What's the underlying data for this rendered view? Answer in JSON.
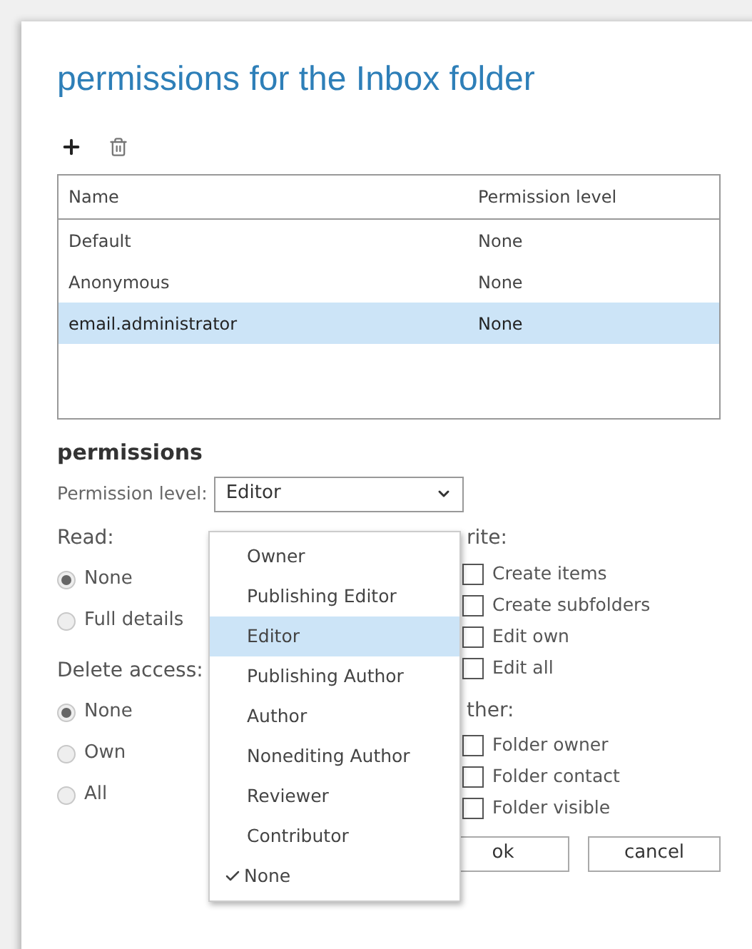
{
  "dialog": {
    "title": "permissions for the Inbox folder"
  },
  "toolbar": [
    {
      "kind": "add"
    },
    {
      "kind": "delete"
    }
  ],
  "table": {
    "columns": [
      "Name",
      "Permission level"
    ],
    "rows": [
      {
        "name": "Default",
        "level_text": "None",
        "selected": false
      },
      {
        "name": "Anonymous",
        "level_text": "None",
        "selected": false
      },
      {
        "name": "email.administrator",
        "level_text": "None",
        "selected": true
      }
    ]
  },
  "permissions": {
    "heading": "permissions",
    "level_label": "Permission level:",
    "level_value": "Editor",
    "read": {
      "label": "Read:",
      "options": [
        {
          "label": "None",
          "selected": true
        },
        {
          "label": "Full details",
          "selected": false
        }
      ]
    },
    "delete": {
      "label": "Delete access:",
      "options": [
        {
          "label": "None",
          "selected": true
        },
        {
          "label": "Own",
          "selected": false
        },
        {
          "label": "All",
          "selected": false
        }
      ]
    },
    "write": {
      "label": "rite:",
      "options": [
        {
          "label": "Create items",
          "checked": false
        },
        {
          "label": "Create subfolders",
          "checked": false
        },
        {
          "label": "Edit own",
          "checked": false
        },
        {
          "label": "Edit all",
          "checked": false
        }
      ]
    },
    "other": {
      "label": "ther:",
      "options": [
        {
          "label": "Folder owner",
          "checked": false
        },
        {
          "label": "Folder contact",
          "checked": false
        },
        {
          "label": "Folder visible",
          "checked": false
        }
      ]
    }
  },
  "menu": [
    {
      "label": "Owner",
      "highlighted": false,
      "checked": false
    },
    {
      "label": "Publishing Editor",
      "highlighted": false,
      "checked": false
    },
    {
      "label": "Editor",
      "highlighted": true,
      "checked": false
    },
    {
      "label": "Publishing Author",
      "highlighted": false,
      "checked": false
    },
    {
      "label": "Author",
      "highlighted": false,
      "checked": false
    },
    {
      "label": "Nonediting Author",
      "highlighted": false,
      "checked": false
    },
    {
      "label": "Reviewer",
      "highlighted": false,
      "checked": false
    },
    {
      "label": "Contributor",
      "highlighted": false,
      "checked": false
    },
    {
      "label": "None",
      "highlighted": false,
      "checked": true
    }
  ],
  "buttons": [
    "ok",
    "cancel"
  ]
}
